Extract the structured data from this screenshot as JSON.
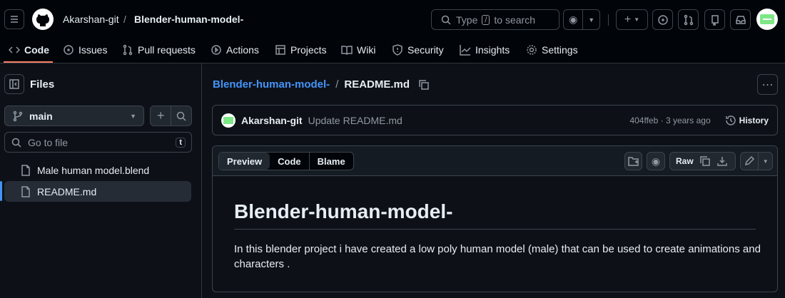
{
  "header": {
    "owner": "Akarshan-git",
    "separator": "/",
    "repo": "Blender-human-model-",
    "search_placeholder_pre": "Type",
    "search_key": "/",
    "search_placeholder_post": "to search"
  },
  "nav": [
    {
      "label": "Code",
      "icon": "code-icon"
    },
    {
      "label": "Issues",
      "icon": "issue-icon"
    },
    {
      "label": "Pull requests",
      "icon": "pull-request-icon"
    },
    {
      "label": "Actions",
      "icon": "play-icon"
    },
    {
      "label": "Projects",
      "icon": "table-icon"
    },
    {
      "label": "Wiki",
      "icon": "book-icon"
    },
    {
      "label": "Security",
      "icon": "shield-icon"
    },
    {
      "label": "Insights",
      "icon": "graph-icon"
    },
    {
      "label": "Settings",
      "icon": "gear-icon"
    }
  ],
  "sidebar": {
    "title": "Files",
    "branch": "main",
    "goto_placeholder": "Go to file",
    "goto_key": "t",
    "files": [
      {
        "name": "Male human model.blend",
        "selected": false
      },
      {
        "name": "README.md",
        "selected": true
      }
    ]
  },
  "breadcrumb": {
    "repo": "Blender-human-model-",
    "sep": "/",
    "file": "README.md"
  },
  "commit": {
    "author": "Akarshan-git",
    "message": "Update README.md",
    "sha": "404ffeb",
    "time": "3 years ago",
    "history": "History"
  },
  "file": {
    "tabs": [
      "Preview",
      "Code",
      "Blame"
    ],
    "raw": "Raw"
  },
  "readme": {
    "title": "Blender-human-model-",
    "body": "In this blender project i have created a low poly human model (male) that can be used to create animations and characters ."
  },
  "colors": {
    "accent": "#4493f8",
    "underline": "#f78166",
    "avatar": "#7ee787"
  }
}
